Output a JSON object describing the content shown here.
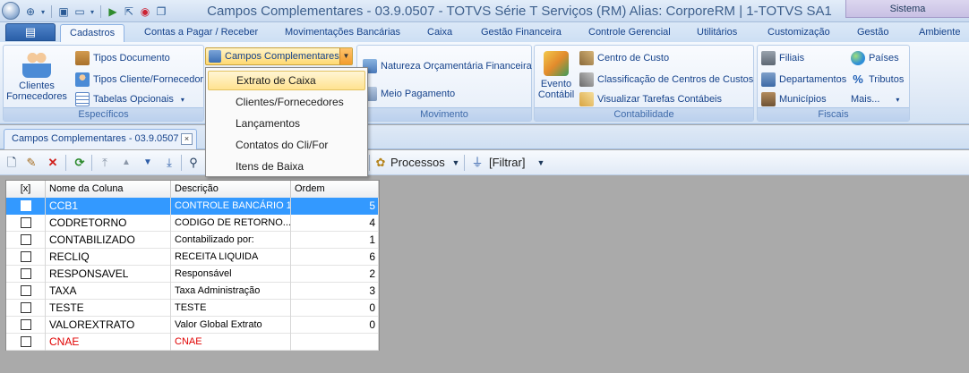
{
  "window": {
    "title": "Campos Complementares - 03.9.0507 - TOTVS Série T Serviços (RM) Alias: CorporeRM | 1-TOTVS SA1",
    "sistema_label": "Sistema"
  },
  "menu_tabs": [
    {
      "label": "Cadastros",
      "active": true
    },
    {
      "label": "Contas a Pagar / Receber"
    },
    {
      "label": "Movimentações Bancárias"
    },
    {
      "label": "Caixa"
    },
    {
      "label": "Gestão Financeira"
    },
    {
      "label": "Controle Gerencial"
    },
    {
      "label": "Utilitários"
    },
    {
      "label": "Customização"
    },
    {
      "label": "Gestão"
    },
    {
      "label": "Ambiente"
    }
  ],
  "ribbon": {
    "especificos": {
      "label": "Específicos",
      "clientes_fornecedores": "Clientes\nFornecedores",
      "tipos_documento": "Tipos Documento",
      "tipos_cliente_fornecedor": "Tipos Cliente/Fornecedor",
      "tabelas_opcionais": "Tabelas Opcionais",
      "campos_complementares": "Campos Complementares"
    },
    "movimento": {
      "label": "Movimento",
      "natureza_orcamentaria": "Natureza Orçamentária Financeira",
      "meio_pagamento": "Meio Pagamento"
    },
    "contabilidade": {
      "label": "Contabilidade",
      "evento_contabil": "Evento\nContábil",
      "centro_custo": "Centro de Custo",
      "classificacao_centros": "Classificação de Centros de Custos",
      "visualizar_tarefas": "Visualizar Tarefas Contábeis"
    },
    "fiscais": {
      "label": "Fiscais",
      "filiais": "Filiais",
      "departamentos": "Departamentos",
      "municipios": "Municípios",
      "paises": "Países",
      "tributos": "Tributos",
      "mais": "Mais..."
    }
  },
  "dropdown": {
    "items": [
      {
        "label": "Extrato de Caixa",
        "highlighted": true
      },
      {
        "label": "Clientes/Fornecedores"
      },
      {
        "label": "Lançamentos"
      },
      {
        "label": "Contatos do Cli/For"
      },
      {
        "label": "Itens de Baixa"
      }
    ]
  },
  "document_tab": {
    "label": "Campos Complementares - 03.9.0507",
    "close": "×"
  },
  "toolbar": {
    "processos": "Processos",
    "filtrar": "[Filtrar]"
  },
  "grid": {
    "columns": [
      "[x]",
      "Nome da Coluna",
      "Descrição",
      "Ordem"
    ],
    "rows": [
      {
        "nome": "CCB1",
        "descricao": "CONTROLE BANCÁRIO 1",
        "ordem": "5",
        "selected": true
      },
      {
        "nome": "CODRETORNO",
        "descricao": "CODIGO DE RETORNO...",
        "ordem": "4"
      },
      {
        "nome": "CONTABILIZADO",
        "descricao": "Contabilizado por:",
        "ordem": "1"
      },
      {
        "nome": "RECLIQ",
        "descricao": "RECEITA LIQUIDA",
        "ordem": "6"
      },
      {
        "nome": "RESPONSAVEL",
        "descricao": "Responsável",
        "ordem": "2"
      },
      {
        "nome": "TAXA",
        "descricao": "Taxa Administração",
        "ordem": "3"
      },
      {
        "nome": "TESTE",
        "descricao": "TESTE",
        "ordem": "0"
      },
      {
        "nome": "VALOREXTRATO",
        "descricao": "Valor Global Extrato",
        "ordem": "0"
      },
      {
        "nome": "CNAE",
        "descricao": "CNAE",
        "ordem": "",
        "red": true
      }
    ]
  },
  "colors": {
    "selected_row": "#3399ff",
    "new_row_text": "#e00000",
    "menu_highlight": "#ffe28f"
  }
}
